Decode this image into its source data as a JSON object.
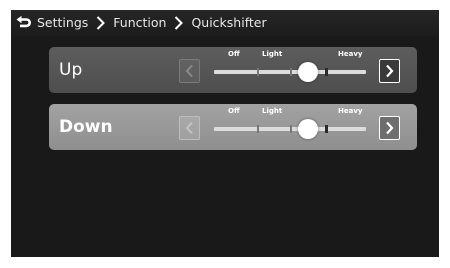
{
  "breadcrumb": {
    "items": [
      "Settings",
      "Function",
      "Quickshifter"
    ]
  },
  "rows": [
    {
      "label": "Up",
      "scale": {
        "off": "Off",
        "light": "Light",
        "heavy": "Heavy"
      },
      "level_fraction": 0.62
    },
    {
      "label": "Down",
      "scale": {
        "off": "Off",
        "light": "Light",
        "heavy": "Heavy"
      },
      "level_fraction": 0.62
    }
  ],
  "icons": {
    "back": "back-arrow-icon",
    "separator": "chevron-right-icon",
    "prev": "chevron-left-icon",
    "next": "chevron-right-icon"
  },
  "colors": {
    "screen_bg": "#191919",
    "row_up_bg": "#565656",
    "row_down_bg": "#9a9a9a",
    "text": "#ffffff"
  }
}
